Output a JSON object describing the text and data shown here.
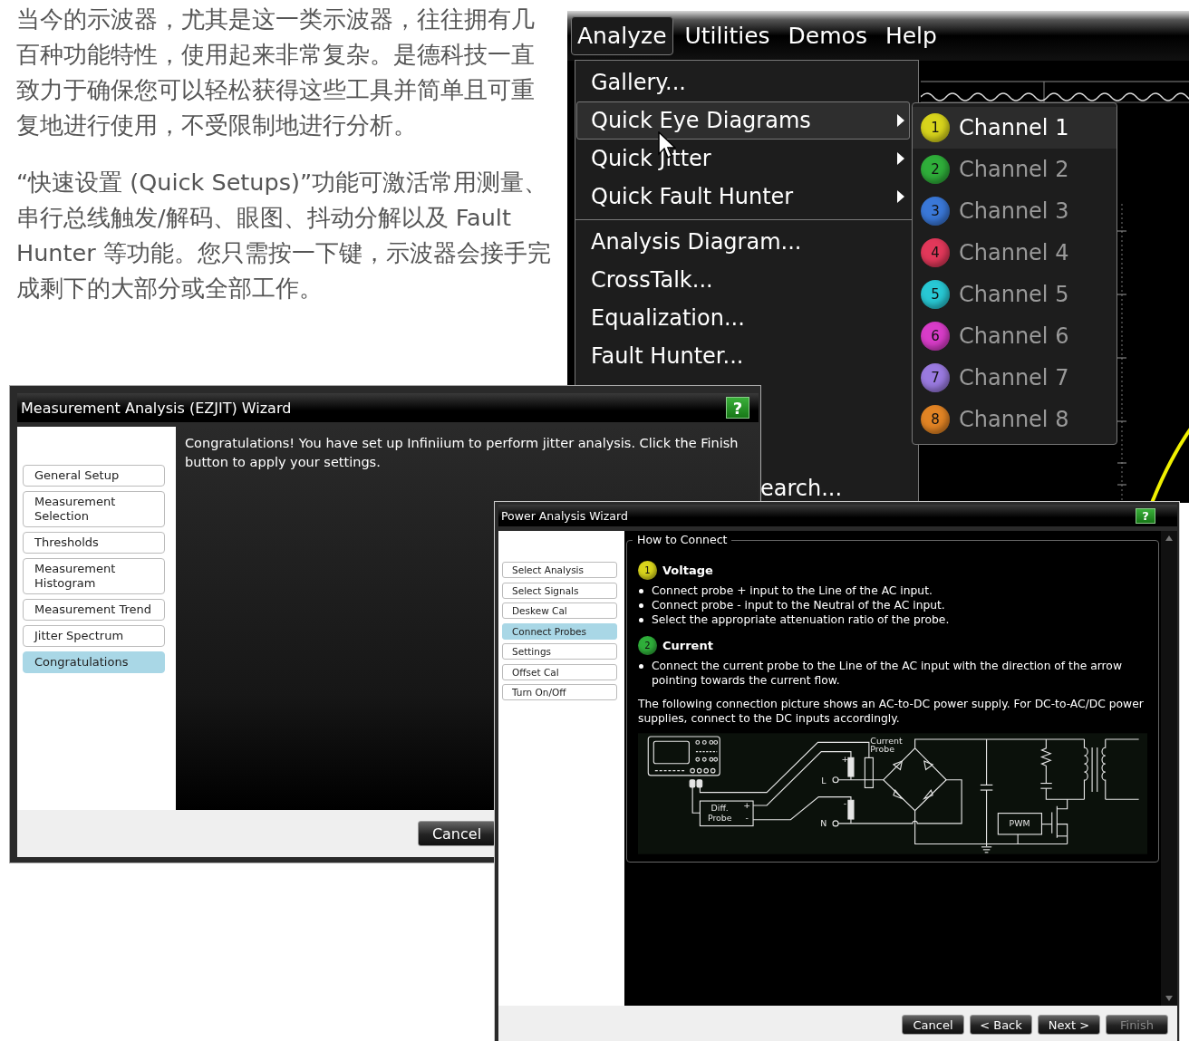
{
  "article": {
    "paragraphs": [
      "当今的示波器，尤其是这一类示波器，往往拥有几百种功能特性，使用起来非常复杂。是德科技一直致力于确保您可以轻松获得这些工具并简单且可重复地进行使用，不受限制地进行分析。",
      "“快速设置 (Quick Setups)”功能可激活常用测量、串行总线触发/解码、眼图、抖动分解以及 Fault Hunter 等功能。您只需按一下键，示波器会接手完成剩下的大部分或全部工作。"
    ]
  },
  "scope_menu": {
    "menu_bar": [
      {
        "label": "Analyze",
        "selected": true
      },
      {
        "label": "Utilities",
        "selected": false
      },
      {
        "label": "Demos",
        "selected": false
      },
      {
        "label": "Help",
        "selected": false
      }
    ],
    "sections": [
      {
        "items": [
          {
            "label": "Gallery...",
            "kind": "action",
            "selected": false
          },
          {
            "label": "Quick Eye Diagrams",
            "kind": "submenu",
            "selected": true
          },
          {
            "label": "Quick Jitter",
            "kind": "submenu",
            "selected": false
          },
          {
            "label": "Quick Fault Hunter",
            "kind": "submenu",
            "selected": false
          }
        ]
      },
      {
        "items": [
          {
            "label": "Analysis Diagram...",
            "kind": "action",
            "selected": false
          },
          {
            "label": "CrossTalk...",
            "kind": "action",
            "selected": false
          },
          {
            "label": "Equalization...",
            "kind": "action",
            "selected": false
          },
          {
            "label": "Fault Hunter...",
            "kind": "action",
            "selected": false
          }
        ]
      }
    ],
    "partial_item": "earch...",
    "submenu": [
      {
        "badge": "1",
        "label": "Channel 1",
        "color": "#d8d41c",
        "selected": true
      },
      {
        "badge": "2",
        "label": "Channel 2",
        "color": "#2fae3a",
        "selected": false
      },
      {
        "badge": "3",
        "label": "Channel 3",
        "color": "#3a78d8",
        "selected": false
      },
      {
        "badge": "4",
        "label": "Channel 4",
        "color": "#e2385a",
        "selected": false
      },
      {
        "badge": "5",
        "label": "Channel 5",
        "color": "#28c8d4",
        "selected": false
      },
      {
        "badge": "6",
        "label": "Channel 6",
        "color": "#d83cc8",
        "selected": false
      },
      {
        "badge": "7",
        "label": "Channel 7",
        "color": "#9a7ae0",
        "selected": false
      },
      {
        "badge": "8",
        "label": "Channel 8",
        "color": "#e28424",
        "selected": false
      }
    ]
  },
  "ezjit_wizard": {
    "title": "Measurement Analysis (EZJIT) Wizard",
    "help": "?",
    "steps": [
      {
        "label": "General Setup",
        "selected": false
      },
      {
        "label": "Measurement Selection",
        "selected": false
      },
      {
        "label": "Thresholds",
        "selected": false
      },
      {
        "label": "Measurement Histogram",
        "selected": false
      },
      {
        "label": "Measurement Trend",
        "selected": false
      },
      {
        "label": "Jitter Spectrum",
        "selected": false
      },
      {
        "label": "Congratulations",
        "selected": true
      }
    ],
    "message": "Congratulations! You have set up Infiniium to perform jitter analysis. Click the Finish button to apply your settings.",
    "buttons": [
      {
        "label": "Cancel",
        "disabled": false
      }
    ]
  },
  "power_wizard": {
    "title": "Power Analysis Wizard",
    "help": "?",
    "steps": [
      {
        "label": "Select Analysis",
        "selected": false
      },
      {
        "label": "Select Signals",
        "selected": false
      },
      {
        "label": "Deskew Cal",
        "selected": false
      },
      {
        "label": "Connect Probes",
        "selected": true
      },
      {
        "label": "Settings",
        "selected": false
      },
      {
        "label": "Offset Cal",
        "selected": false
      },
      {
        "label": "Turn On/Off",
        "selected": false
      }
    ],
    "section_title": "How to Connect",
    "groups": [
      {
        "badge": "1",
        "color": "#d8d41c",
        "heading": "Voltage",
        "bullets": [
          "Connect probe + input to the Line of the AC input.",
          "Connect probe - input to the Neutral of the AC input.",
          "Select the appropriate attenuation ratio of the probe."
        ]
      },
      {
        "badge": "2",
        "color": "#2fae3a",
        "heading": "Current",
        "bullets": [
          "Connect the current probe to the Line of the AC input with the direction of the arrow pointing towards the current flow."
        ]
      }
    ],
    "note": "The following connection picture shows an AC-to-DC power supply. For DC-to-AC/DC power supplies, connect to the DC inputs accordingly.",
    "diagram": {
      "labels": [
        "Current",
        "Probe",
        "L",
        "N",
        "Diff.",
        "Probe",
        "+",
        "-",
        "+",
        "-",
        "PWM"
      ]
    },
    "buttons": [
      {
        "label": "Cancel",
        "disabled": false
      },
      {
        "label": "< Back",
        "disabled": false
      },
      {
        "label": "Next >",
        "disabled": false
      },
      {
        "label": "Finish",
        "disabled": true
      }
    ]
  }
}
